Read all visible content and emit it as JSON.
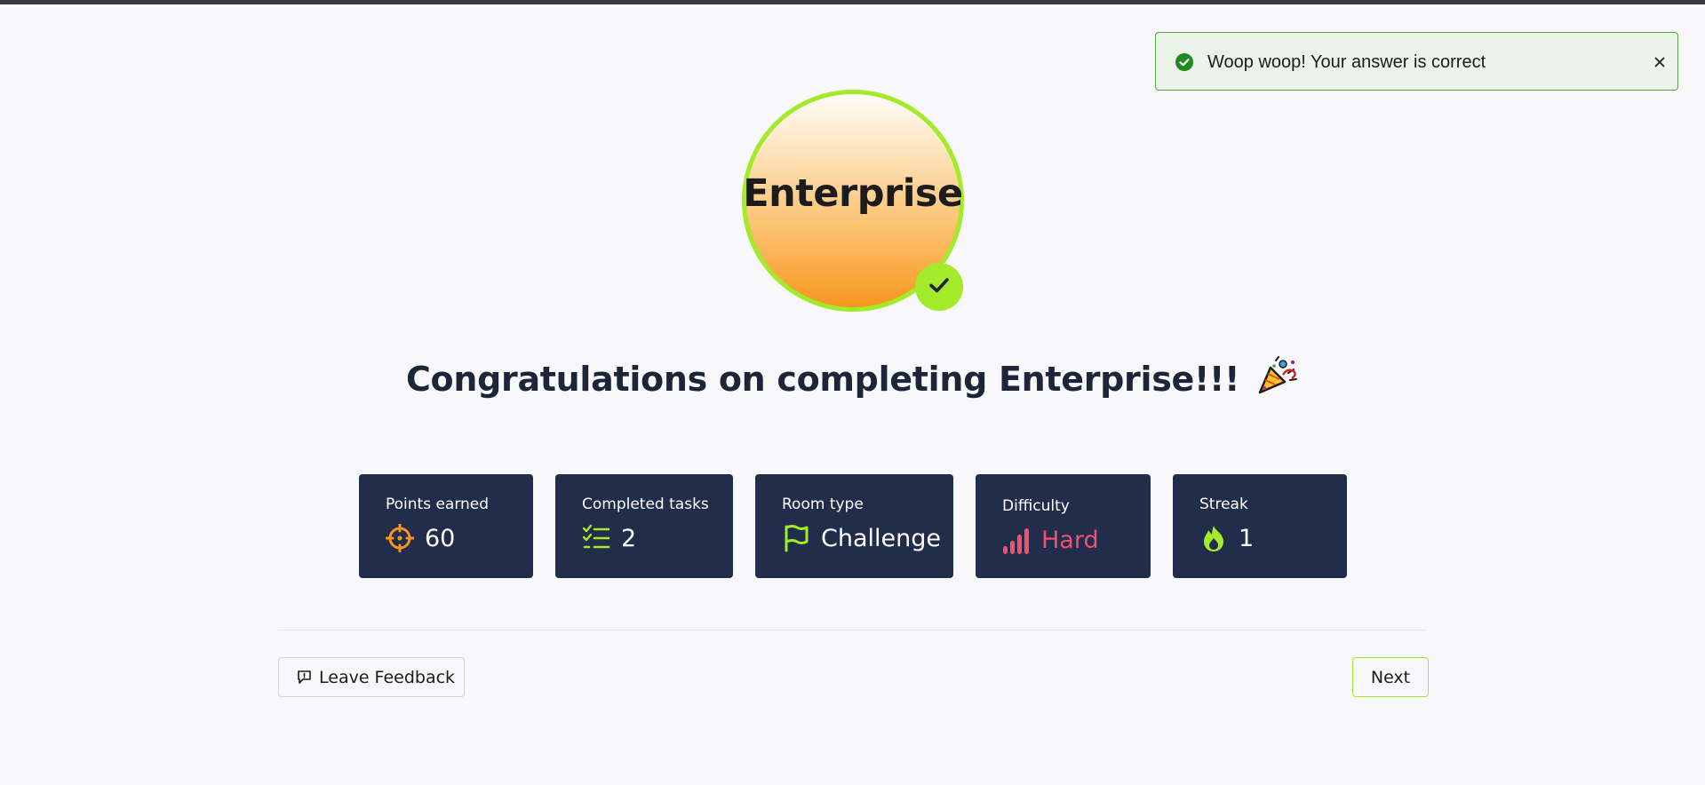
{
  "toast": {
    "message": "Woop woop! Your answer is correct",
    "status_icon": "check-circle-icon",
    "close_icon": "close-icon"
  },
  "badge": {
    "title": "Enterprise",
    "completed_icon": "checkmark-icon"
  },
  "heading": {
    "text": "Congratulations on completing Enterprise!!!",
    "emoji_icon": "party-popper-icon"
  },
  "stats": {
    "points": {
      "label": "Points earned",
      "value": "60",
      "icon": "target-icon"
    },
    "tasks": {
      "label": "Completed tasks",
      "value": "2",
      "icon": "checklist-icon"
    },
    "room_type": {
      "label": "Room type",
      "value": "Challenge",
      "icon": "flag-icon"
    },
    "difficulty": {
      "label": "Difficulty",
      "value": "Hard",
      "icon": "signal-bars-icon"
    },
    "streak": {
      "label": "Streak",
      "value": "1",
      "icon": "flame-icon"
    }
  },
  "actions": {
    "feedback_label": "Leave Feedback",
    "next_label": "Next"
  },
  "colors": {
    "accent_green": "#a3ea2a",
    "card_bg": "#212d4b",
    "points_orange": "#f7931e",
    "hard_red": "#f0506e",
    "toast_bg": "#e9f3e7",
    "toast_border": "#5da24c"
  }
}
